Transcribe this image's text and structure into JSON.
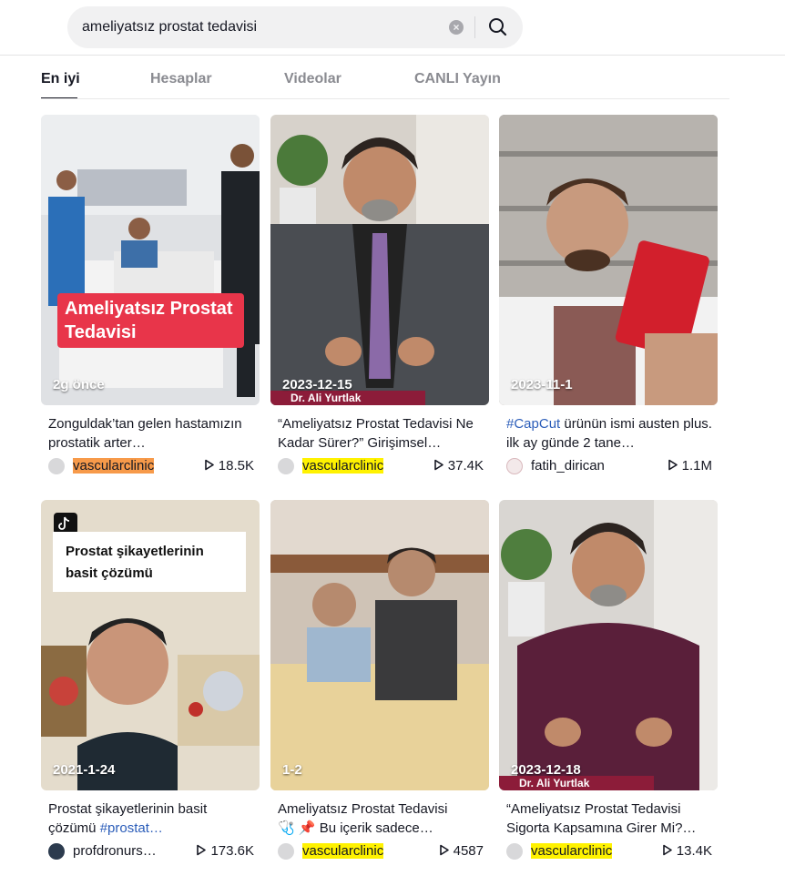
{
  "search": {
    "query": "ameliyatsız prostat tedavisi"
  },
  "tabs": [
    "En iyi",
    "Hesaplar",
    "Videolar",
    "CANLI Yayın"
  ],
  "colors": {
    "highlight_yellow": "#fff200",
    "highlight_orange": "#f79a4a",
    "hashtag": "#2b5db9"
  },
  "cards": [
    {
      "date": "2g önce",
      "overlay": "Ameliyatsız Prostat Tedavisi",
      "desc": "Zonguldak’tan gelen hastamızın prostatik arter…",
      "author": "vascularclinic",
      "views": "18.5K"
    },
    {
      "date": "2023-12-15",
      "overlay": "Dr. Ali Yurtlak",
      "desc": "“Ameliyatsız Prostat Tedavisi Ne Kadar Sürer?” Girişimsel…",
      "author": "vascularclinic",
      "views": "37.4K"
    },
    {
      "date": "2023-11-1",
      "hashtag": "#CapCut",
      "desc": " ürünün ismi austen plus. ilk ay günde 2 tane…",
      "author": "fatih_dirican",
      "views": "1.1M",
      "product_text": "AUSTEN PLUS"
    },
    {
      "date": "2021-1-24",
      "overlay": "Prostat şikayetlerinin basit çözümü",
      "desc": "Prostat şikayetlerinin basit çözümü ",
      "hashtag": "#prostat…",
      "author": "profdronurs…",
      "views": "173.6K"
    },
    {
      "date": "1-2",
      "desc": "Ameliyatsız Prostat Tedavisi",
      "desc2": "🩺 📌 Bu içerik sadece…",
      "author": "vascularclinic",
      "views": "4587"
    },
    {
      "date": "2023-12-18",
      "overlay": "Dr. Ali Yurtlak",
      "desc": "“Ameliyatsız Prostat Tedavisi Sigorta Kapsamına Girer Mi?…",
      "author": "vascularclinic",
      "views": "13.4K"
    }
  ]
}
